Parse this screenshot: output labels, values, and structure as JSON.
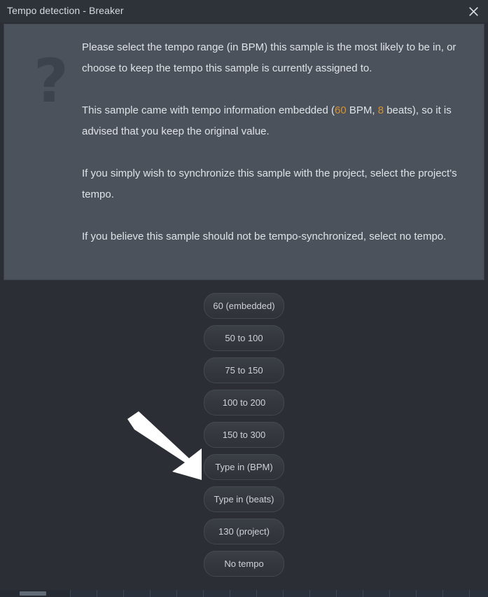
{
  "window": {
    "title": "Tempo detection - Breaker",
    "close_icon": "close-icon"
  },
  "dialog": {
    "help_icon": "?",
    "paragraphs": [
      {
        "id": "p1",
        "segments": [
          {
            "text": "Please select the tempo range (in BPM) this sample is the most likely to be in, or choose to keep the tempo this sample is currently assigned to.",
            "accent": false
          }
        ]
      },
      {
        "id": "p2",
        "segments": [
          {
            "text": "This sample came with tempo information embedded (",
            "accent": false
          },
          {
            "text": "60",
            "accent": true
          },
          {
            "text": " BPM, ",
            "accent": false
          },
          {
            "text": "8",
            "accent": true
          },
          {
            "text": " beats), so it is advised that you keep the original value.",
            "accent": false
          }
        ]
      },
      {
        "id": "p3",
        "segments": [
          {
            "text": "If you simply wish to synchronize this sample with the project, select the project's tempo.",
            "accent": false
          }
        ]
      },
      {
        "id": "p4",
        "segments": [
          {
            "text": "If you believe this sample should not be tempo-synchronized, select no tempo.",
            "accent": false
          }
        ]
      }
    ],
    "embedded_bpm": "60",
    "embedded_beats": "8",
    "accent_color": "#d9922f"
  },
  "choices": [
    {
      "id": "embedded",
      "label": "60 (embedded)"
    },
    {
      "id": "50-100",
      "label": "50 to 100"
    },
    {
      "id": "75-150",
      "label": "75 to 150"
    },
    {
      "id": "100-200",
      "label": "100 to 200"
    },
    {
      "id": "150-300",
      "label": "150 to 300"
    },
    {
      "id": "type-bpm",
      "label": "Type in (BPM)"
    },
    {
      "id": "type-beats",
      "label": "Type in (beats)"
    },
    {
      "id": "project",
      "label": "130 (project)"
    },
    {
      "id": "no-tempo",
      "label": "No tempo"
    }
  ],
  "annotation": {
    "arrow_icon": "arrow-down-right-icon",
    "points_to": "Type in (BPM)",
    "color": "#ffffff"
  },
  "colors": {
    "titlebar_bg": "#2e333a",
    "dialog_bg": "#2b2f35",
    "panel_bg": "#4b525b",
    "button_bg": "#363b41",
    "text": "#dfe3e7",
    "accent": "#d9922f"
  }
}
